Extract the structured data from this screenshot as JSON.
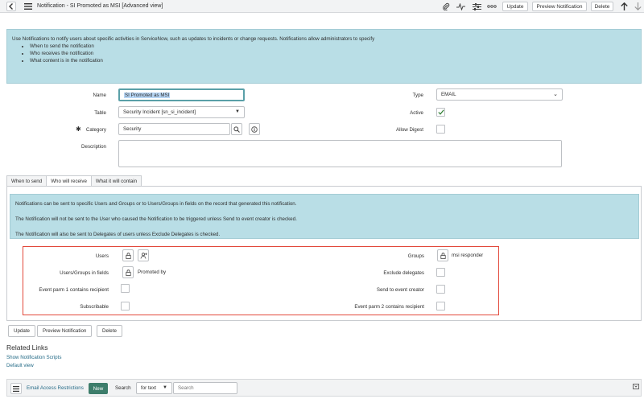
{
  "header": {
    "title": "Notification - SI Promoted as MSI [Advanced view]",
    "update_label": "Update",
    "preview_label": "Preview Notification",
    "delete_label": "Delete"
  },
  "info": {
    "intro": "Use Notifications to notify users about specific activities in ServiceNow, such as updates to incidents or change requests. Notifications allow administrators to specify",
    "bullets": [
      "When to send the notification",
      "Who receives the notification",
      "What content is in the notification"
    ]
  },
  "form": {
    "name_label": "Name",
    "name_value": "SI Promoted as MSI",
    "table_label": "Table",
    "table_value": "Security Incident [sn_si_incident]",
    "category_label": "Category",
    "category_value": "Security",
    "description_label": "Description",
    "type_label": "Type",
    "type_value": "EMAIL",
    "active_label": "Active",
    "allow_digest_label": "Allow Digest"
  },
  "tabs": [
    "When to send",
    "Who will receive",
    "What it will contain"
  ],
  "receive": {
    "line1": "Notifications can be sent to specific Users and Groups or to Users/Groups in fields on the record that generated this notification.",
    "line2": "The Notification will not be sent to the User who caused the Notification to be triggered unless Send to event creator is checked.",
    "line3": "The Notification will also be sent to Delegates of users unless Exclude Delegates is checked.",
    "users_label": "Users",
    "users_groups_fields_label": "Users/Groups in fields",
    "users_groups_fields_value": "Promoted by",
    "event_parm1_label": "Event parm 1 contains recipient",
    "subscribable_label": "Subscribable",
    "groups_label": "Groups",
    "groups_value": "msi responder",
    "exclude_delegates_label": "Exclude delegates",
    "send_event_creator_label": "Send to event creator",
    "event_parm2_label": "Event parm 2 contains recipient"
  },
  "footer_buttons": {
    "update": "Update",
    "preview": "Preview Notification",
    "delete": "Delete"
  },
  "related": {
    "title": "Related Links",
    "links": [
      "Show Notification Scripts",
      "Default view"
    ]
  },
  "bottom": {
    "list_title": "Email Access Restrictions",
    "new_label": "New",
    "search_label": "Search",
    "search_field": "for text",
    "search_placeholder": "Search"
  }
}
